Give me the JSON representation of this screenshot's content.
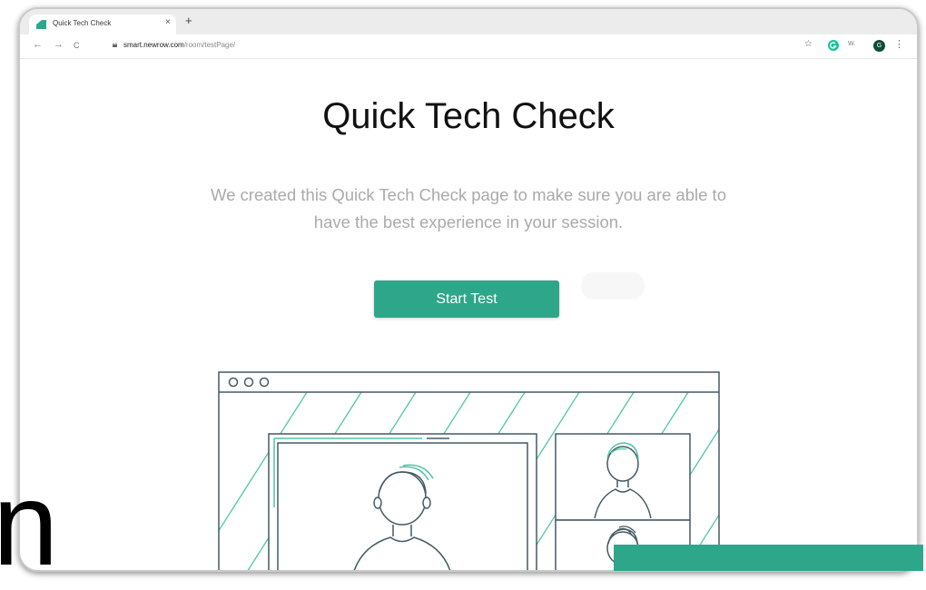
{
  "browser": {
    "tab": {
      "title": "Quick Tech Check",
      "close": "×"
    },
    "new_tab": "+",
    "nav": {
      "back": "←",
      "forward": "→",
      "reload": "C"
    },
    "address": {
      "domain": "smart.newrow.com",
      "path": "/room/testPage/"
    },
    "extension_label": "W.",
    "avatar_initial": "G",
    "menu": "⋮",
    "star": "☆"
  },
  "page": {
    "title": "Quick Tech Check",
    "description": "We created this Quick Tech Check page to make sure you are able to have the best experience in your session.",
    "start_button": "Start Test"
  },
  "overlay": {
    "glyph": "n"
  },
  "colors": {
    "accent": "#2ea68a",
    "illustration_line": "#455a64",
    "illustration_accent": "#4fc6a5"
  }
}
